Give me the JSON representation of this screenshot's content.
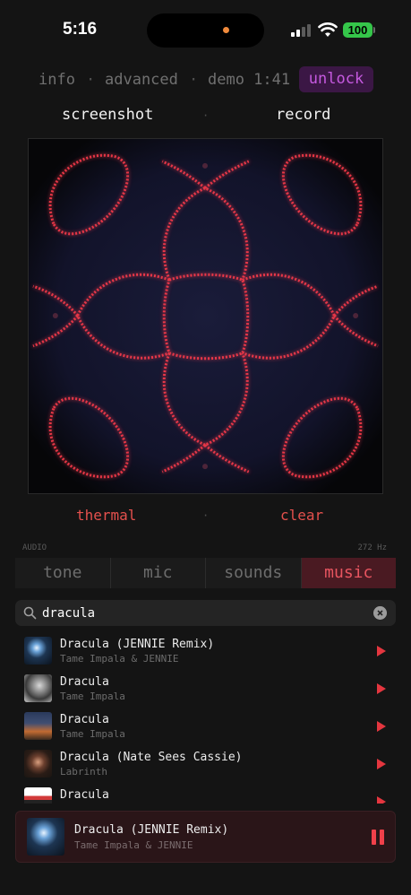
{
  "status_bar": {
    "time": "5:16",
    "battery": "100"
  },
  "nav": {
    "info": "info",
    "advanced": "advanced",
    "demo": "demo 1:41",
    "unlock": "unlock",
    "separator": "·"
  },
  "actions": {
    "screenshot": "screenshot",
    "record": "record"
  },
  "modes": {
    "thermal": "thermal",
    "clear": "clear"
  },
  "audio": {
    "label": "AUDIO",
    "frequency": "272 Hz"
  },
  "tabs": [
    "tone",
    "mic",
    "sounds",
    "music"
  ],
  "active_tab": "music",
  "search": {
    "value": "dracula",
    "placeholder": ""
  },
  "results": [
    {
      "title": "Dracula (JENNIE Remix)",
      "artist": "Tame Impala & JENNIE"
    },
    {
      "title": "Dracula",
      "artist": "Tame Impala"
    },
    {
      "title": "Dracula",
      "artist": "Tame Impala"
    },
    {
      "title": "Dracula (Nate Sees Cassie)",
      "artist": "Labrinth"
    },
    {
      "title": "Dracula",
      "artist": ""
    }
  ],
  "now_playing": {
    "title": "Dracula (JENNIE Remix)",
    "artist": "Tame Impala & JENNIE"
  },
  "colors": {
    "accent_red": "#e4363f",
    "unlock_purple": "#c65ae0",
    "active_tab_bg": "#4a1a22",
    "battery_green": "#35c64a"
  },
  "icons": {
    "search": "search-icon",
    "clear": "clear-icon",
    "play": "play-icon",
    "pause": "pause-icon",
    "wifi": "wifi-icon",
    "signal": "signal-icon",
    "battery": "battery-icon"
  }
}
